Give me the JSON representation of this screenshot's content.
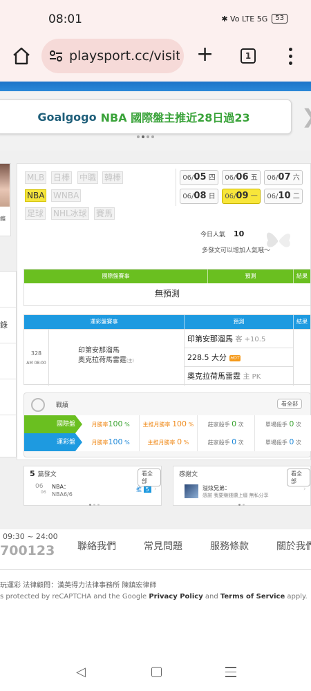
{
  "status_bar": {
    "time": "08:01",
    "icons": "✱ Vo LTE 5G",
    "battery": "53"
  },
  "browser": {
    "url": "playsport.cc/visit",
    "tab_count": "1"
  },
  "banner": {
    "brand": "Goalgogo",
    "text": "NBA 國際盤主推近28日過23"
  },
  "sidebar": {
    "avatar_label": "癮",
    "menu_label": "錄"
  },
  "sports": {
    "row1": [
      "MLB",
      "日棒",
      "中職",
      "韓棒"
    ],
    "row2": [
      "NBA",
      "WNBA"
    ],
    "row3": [
      "足球",
      "NHL冰球",
      "賽馬"
    ]
  },
  "dates": [
    {
      "md": "06/",
      "day": "05",
      "wd": "四"
    },
    {
      "md": "06/",
      "day": "06",
      "wd": "五"
    },
    {
      "md": "06/",
      "day": "07",
      "wd": "六"
    },
    {
      "md": "06/",
      "day": "08",
      "wd": "日"
    },
    {
      "md": "06/",
      "day": "09",
      "wd": "一"
    },
    {
      "md": "06/",
      "day": "10",
      "wd": "二"
    }
  ],
  "popularity": {
    "label": "今日人氣",
    "value": "10",
    "hint": "多發文可以增加人氣哦～"
  },
  "intl_table": {
    "headers": [
      "國際盤賽事",
      "預測",
      "結果"
    ],
    "empty": "無預測"
  },
  "lottery_table": {
    "headers": [
      "運彩盤賽事",
      "預測",
      "結果"
    ],
    "game": {
      "no": "328",
      "time": "AM 08:00",
      "team1": "印第安那溜馬",
      "team2": "奧克拉荷馬雷霆",
      "team2_tag": "(主)"
    },
    "predictions": [
      {
        "text": "印第安那溜馬",
        "note": "客 +10.5"
      },
      {
        "text": "228.5 大分",
        "note": ""
      },
      {
        "text": "奧克拉荷馬雷霆",
        "note": "主 PK"
      }
    ]
  },
  "record": {
    "title": "戰績",
    "see_all": "看全部",
    "rows": [
      {
        "badge": "國際盤",
        "win_label": "月勝率",
        "win": "100",
        "main_label": "主推月勝率",
        "main": "100",
        "kill_label": "莊家殺手",
        "kill": "0",
        "kill_unit": "次",
        "single_label": "單場殺手",
        "single": "0",
        "single_unit": "次"
      },
      {
        "badge": "運彩盤",
        "win_label": "月勝率",
        "win": "100",
        "main_label": "主推月勝率",
        "main": "0",
        "kill_label": "莊家殺手",
        "kill": "0",
        "kill_unit": "次",
        "single_label": "單場殺手",
        "single": "0",
        "single_unit": "次"
      }
    ]
  },
  "posts": {
    "count": "5",
    "title": "篇發文",
    "see_all": "看全部",
    "date_day": "06",
    "date_sub": "06",
    "league": "NBA：",
    "subject": "NBA6/6",
    "tag": "推",
    "tag_count": "5"
  },
  "thanks": {
    "title": "感謝文",
    "see_all": "看全部",
    "author": "溢炫兄弟：",
    "text": "感謝 我要賺錢鑽上癮 無私分享"
  },
  "footer": {
    "hours": "09:30 ~ 24:00",
    "phone": "700123",
    "links": [
      "聯絡我們",
      "常見問題",
      "服務條款",
      "關於我們"
    ],
    "legal": "玩運彩 法律顧問：漢英得力法律事務所 陳鎮宏律師",
    "captcha_pre": "s protected by reCAPTCHA and the Google ",
    "privacy": "Privacy Policy",
    "and": " and ",
    "terms": "Terms of Service",
    "apply": " apply."
  }
}
